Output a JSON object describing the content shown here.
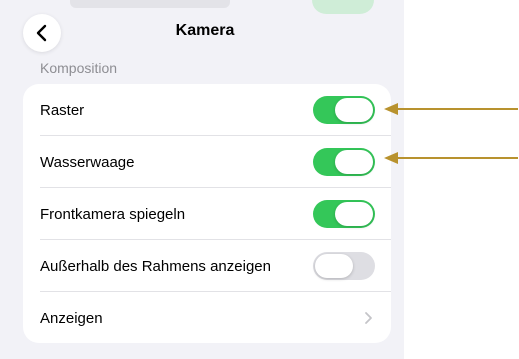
{
  "nav": {
    "title": "Kamera",
    "back_icon": "chevron-left-icon"
  },
  "section": {
    "header": "Komposition"
  },
  "rows": [
    {
      "label": "Raster",
      "control": "toggle",
      "on": true
    },
    {
      "label": "Wasserwaage",
      "control": "toggle",
      "on": true
    },
    {
      "label": "Frontkamera spiegeln",
      "control": "toggle",
      "on": true
    },
    {
      "label": "Außerhalb des Rahmens anzeigen",
      "control": "toggle",
      "on": false
    },
    {
      "label": "Anzeigen",
      "control": "disclosure",
      "icon": "chevron-right-icon"
    }
  ],
  "annotations": {
    "arrow_color": "#b8922e",
    "arrow_icon": "arrow-left-icon"
  },
  "colors": {
    "toggle_on": "#34c759",
    "toggle_off": "#dedee3",
    "background": "#f2f2f7"
  }
}
